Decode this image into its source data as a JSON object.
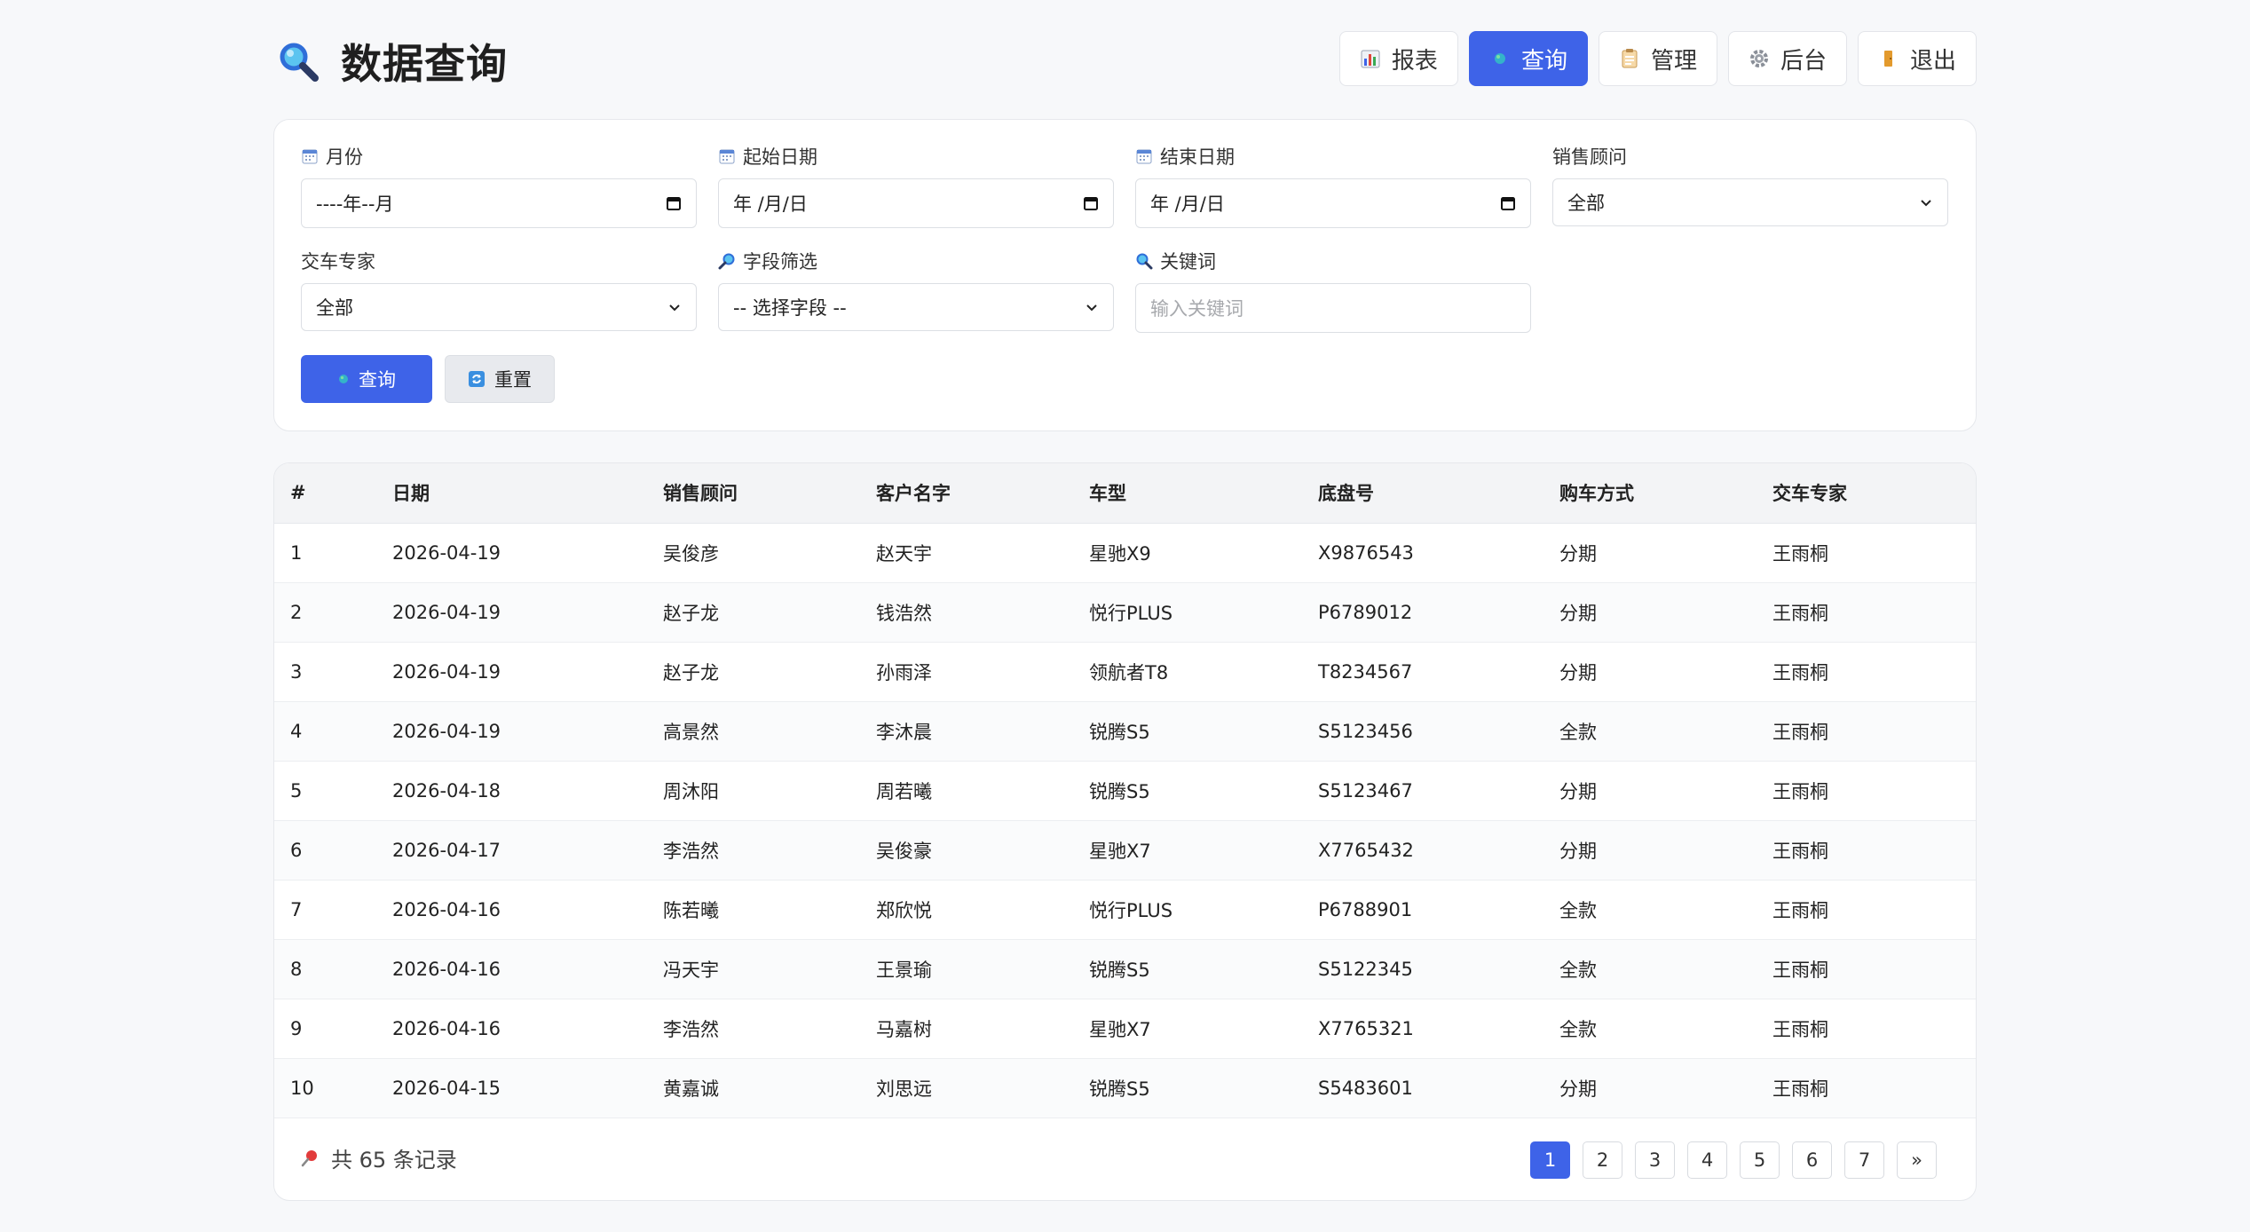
{
  "header": {
    "title": "数据查询",
    "nav": [
      {
        "label": "报表",
        "icon": "bar-chart-icon",
        "active": false
      },
      {
        "label": "查询",
        "icon": "globe-icon",
        "active": true
      },
      {
        "label": "管理",
        "icon": "clipboard-icon",
        "active": false
      },
      {
        "label": "后台",
        "icon": "gear-icon",
        "active": false
      },
      {
        "label": "退出",
        "icon": "door-icon",
        "active": false
      }
    ]
  },
  "filters": {
    "month": {
      "label": "月份",
      "value": "----年--月"
    },
    "start_date": {
      "label": "起始日期",
      "value": "年 /月/日"
    },
    "end_date": {
      "label": "结束日期",
      "value": "年 /月/日"
    },
    "sales_advisor": {
      "label": "销售顾问",
      "value": "全部"
    },
    "delivery_expert": {
      "label": "交车专家",
      "value": "全部"
    },
    "field_filter": {
      "label": "字段筛选",
      "value": "-- 选择字段 --"
    },
    "keyword": {
      "label": "关键词",
      "placeholder": "输入关键词"
    },
    "query_label": "查询",
    "reset_label": "重置"
  },
  "table": {
    "columns": [
      "#",
      "日期",
      "销售顾问",
      "客户名字",
      "车型",
      "底盘号",
      "购车方式",
      "交车专家"
    ],
    "rows": [
      [
        "1",
        "2026-04-19",
        "吴俊彦",
        "赵天宇",
        "星驰X9",
        "X9876543",
        "分期",
        "王雨桐"
      ],
      [
        "2",
        "2026-04-19",
        "赵子龙",
        "钱浩然",
        "悦行PLUS",
        "P6789012",
        "分期",
        "王雨桐"
      ],
      [
        "3",
        "2026-04-19",
        "赵子龙",
        "孙雨泽",
        "领航者T8",
        "T8234567",
        "分期",
        "王雨桐"
      ],
      [
        "4",
        "2026-04-19",
        "高景然",
        "李沐晨",
        "锐腾S5",
        "S5123456",
        "全款",
        "王雨桐"
      ],
      [
        "5",
        "2026-04-18",
        "周沐阳",
        "周若曦",
        "锐腾S5",
        "S5123467",
        "分期",
        "王雨桐"
      ],
      [
        "6",
        "2026-04-17",
        "李浩然",
        "吴俊豪",
        "星驰X7",
        "X7765432",
        "分期",
        "王雨桐"
      ],
      [
        "7",
        "2026-04-16",
        "陈若曦",
        "郑欣悦",
        "悦行PLUS",
        "P6788901",
        "全款",
        "王雨桐"
      ],
      [
        "8",
        "2026-04-16",
        "冯天宇",
        "王景瑜",
        "锐腾S5",
        "S5122345",
        "全款",
        "王雨桐"
      ],
      [
        "9",
        "2026-04-16",
        "李浩然",
        "马嘉树",
        "星驰X7",
        "X7765321",
        "全款",
        "王雨桐"
      ],
      [
        "10",
        "2026-04-15",
        "黄嘉诚",
        "刘思远",
        "锐腾S5",
        "S5483601",
        "分期",
        "王雨桐"
      ]
    ]
  },
  "footer": {
    "count_text": "共 65 条记录",
    "pages": [
      "1",
      "2",
      "3",
      "4",
      "5",
      "6",
      "7",
      "»"
    ],
    "current_page": "1"
  },
  "colors": {
    "accent": "#3e63e8"
  }
}
